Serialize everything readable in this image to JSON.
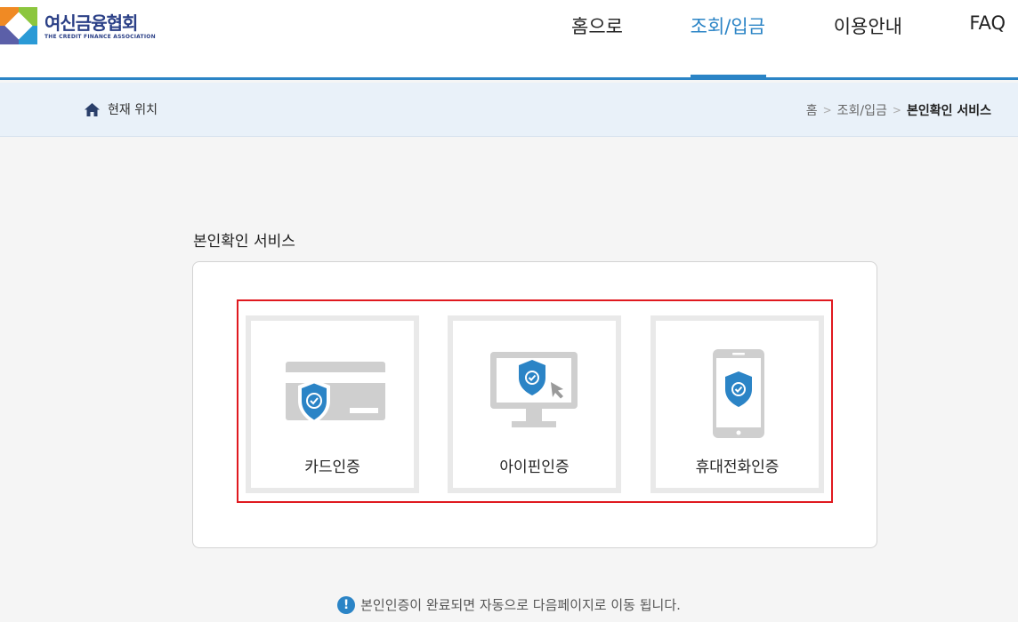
{
  "logo": {
    "name_ko": "여신금융협회",
    "name_en": "THE CREDIT FINANCE ASSOCIATION"
  },
  "nav": {
    "items": [
      {
        "label": "홈으로"
      },
      {
        "label": "조회/입금",
        "active": true
      },
      {
        "label": "이용안내"
      },
      {
        "label": "FAQ"
      }
    ]
  },
  "location": {
    "label": "현재 위치",
    "breadcrumb": [
      "홈",
      "조회/입금",
      "본인확인 서비스"
    ]
  },
  "main": {
    "title": "본인확인 서비스",
    "cards": [
      {
        "label": "카드인증",
        "icon": "card-shield-icon"
      },
      {
        "label": "아이핀인증",
        "icon": "monitor-shield-icon"
      },
      {
        "label": "휴대전화인증",
        "icon": "phone-shield-icon"
      }
    ],
    "notice": "본인인증이 완료되면 자동으로 다음페이지로 이동 됩니다."
  },
  "colors": {
    "accent": "#2b84c6",
    "highlight_border": "#e0191f",
    "icon_gray": "#cfcfcf"
  }
}
